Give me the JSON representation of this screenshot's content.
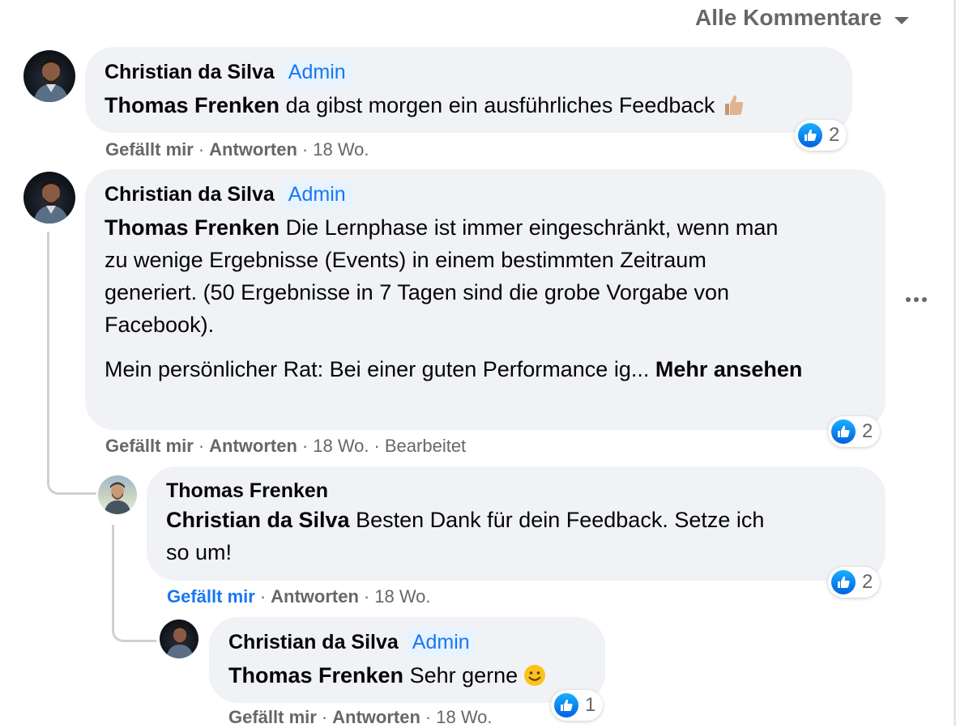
{
  "sort": {
    "label": "Alle Kommentare"
  },
  "comments": [
    {
      "author": "Christian da Silva",
      "badge": "Admin",
      "mention": "Thomas Frenken",
      "text": "da gibst morgen ein ausführliches Feedback",
      "emoji": "thumbs-up-emoji",
      "reactions": {
        "icon": "like-icon",
        "count": "2"
      },
      "actions": {
        "like": "Gefällt mir",
        "reply": "Antworten",
        "time": "18 Wo."
      }
    },
    {
      "author": "Christian da Silva",
      "badge": "Admin",
      "mention": "Thomas Frenken",
      "text_lines": [
        "Die Lernphase ist immer eingeschränkt, wenn man",
        "zu wenige Ergebnisse (Events) in einem bestimmten Zeitraum",
        "generiert. (50 Ergebnisse in 7 Tagen sind die grobe Vorgabe von",
        "Facebook)."
      ],
      "paragraph2": "Mein persönlicher Rat: Bei einer guten Performance ig...",
      "more_label": "Mehr ansehen",
      "reactions": {
        "icon": "like-icon",
        "count": "2"
      },
      "actions": {
        "like": "Gefällt mir",
        "reply": "Antworten",
        "time": "18 Wo.",
        "edited": "Bearbeitet"
      }
    },
    {
      "author": "Thomas Frenken",
      "mention": "Christian da Silva",
      "text_line1": "Besten Dank für dein Feedback. Setze ich",
      "text_line2": "so um!",
      "reactions": {
        "icon": "like-icon",
        "count": "2"
      },
      "actions": {
        "like": "Gefällt mir",
        "reply": "Antworten",
        "time": "18 Wo."
      },
      "liked_by_viewer": true
    },
    {
      "author": "Christian da Silva",
      "badge": "Admin",
      "mention": "Thomas Frenken",
      "text": "Sehr gerne",
      "emoji": "smiling-face-emoji",
      "reactions": {
        "icon": "like-icon",
        "count": "1"
      },
      "actions": {
        "like": "Gefällt mir",
        "reply": "Antworten",
        "time": "18 Wo."
      }
    }
  ],
  "icons": {
    "menu": "more-options-icon",
    "sort": "chevron-down-icon"
  },
  "colors": {
    "bubble": "#f0f2f5",
    "text": "#050505",
    "secondary": "#65676b",
    "accent_blue": "#1877f2",
    "admin_badge_bg": "#e7f3ff",
    "thread_line": "#ced0d4"
  }
}
